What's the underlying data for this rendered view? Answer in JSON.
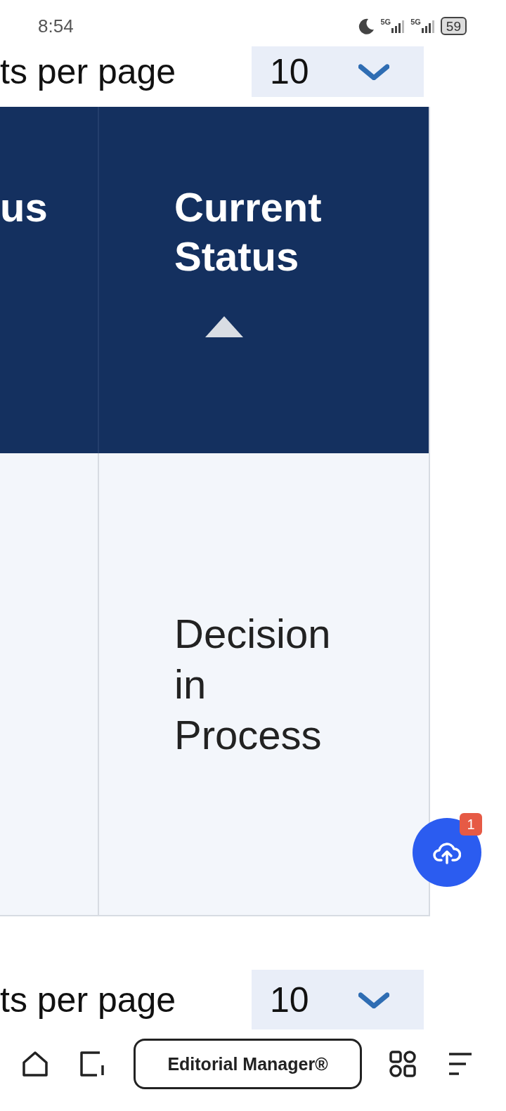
{
  "status_bar": {
    "time": "8:54",
    "networks": [
      "5G",
      "5G"
    ],
    "battery": "59"
  },
  "pager_top": {
    "label": "ts per page",
    "value": "10"
  },
  "table": {
    "columns": [
      {
        "label": "us"
      },
      {
        "label": "Current Status",
        "sort_ascending": true
      }
    ],
    "rows": [
      {
        "current_status": "Decision in Process"
      }
    ]
  },
  "upload_button": {
    "badge": "1"
  },
  "pager_bottom": {
    "label": "ts per page",
    "value": "10"
  },
  "nav_bar": {
    "title": "Editorial Manager®"
  }
}
